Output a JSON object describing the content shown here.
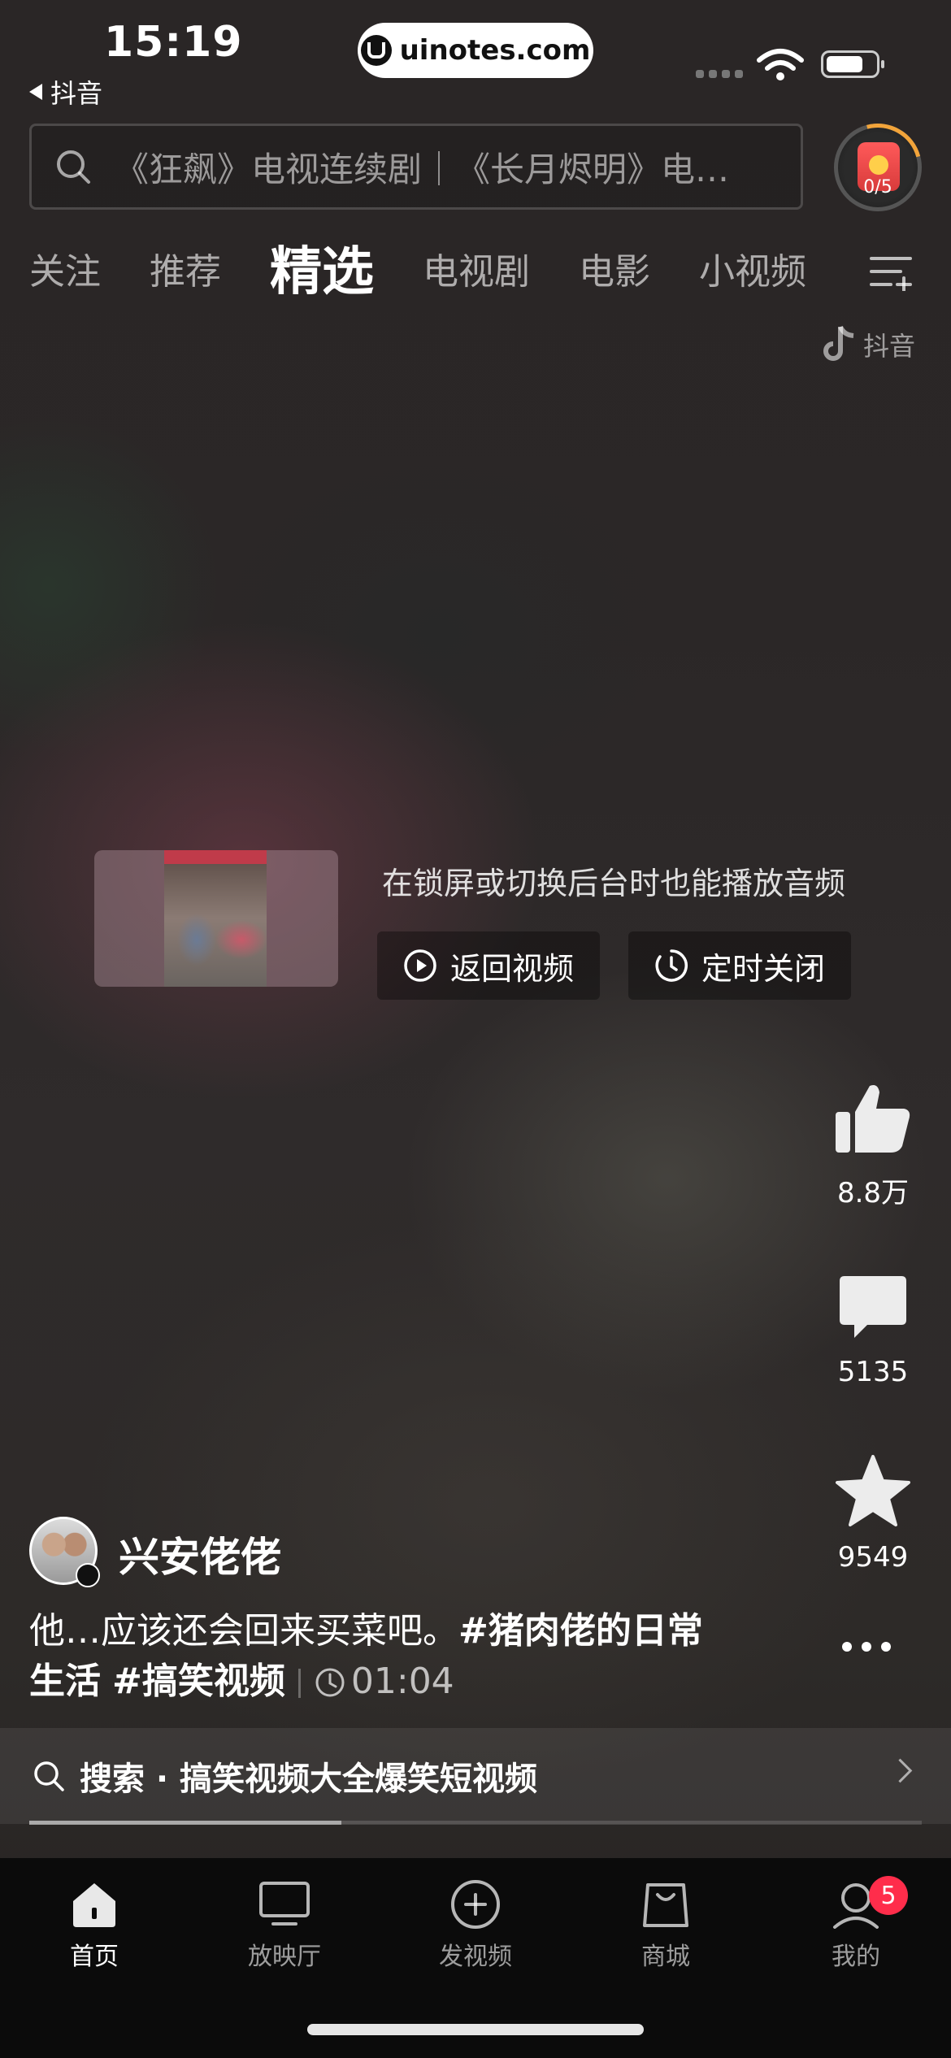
{
  "status_bar": {
    "time": "15:19",
    "back_app": "抖音",
    "url": "uinotes.com"
  },
  "search": {
    "placeholder_text": "《狂飙》电视连续剧｜《长月烬明》电…"
  },
  "reward": {
    "progress": "0/5"
  },
  "tabs": [
    {
      "label": "关注",
      "active": false
    },
    {
      "label": "推荐",
      "active": false
    },
    {
      "label": "精选",
      "active": true
    },
    {
      "label": "电视剧",
      "active": false
    },
    {
      "label": "电影",
      "active": false
    },
    {
      "label": "小视频",
      "active": false
    }
  ],
  "watermark": "抖音",
  "background_play": {
    "message": "在锁屏或切换后台时也能播放音频",
    "return_label": "返回视频",
    "timer_label": "定时关闭"
  },
  "actions": {
    "likes": "8.8万",
    "comments": "5135",
    "favorites": "9549"
  },
  "author": {
    "name": "兴安佬佬"
  },
  "caption": {
    "text": "他…应该还会回来买菜吧。",
    "tag1": "#猪肉佬的日常生活",
    "tag2": "#搞笑视频",
    "duration": "01:04"
  },
  "related_search": {
    "label": "搜索 · 搞笑视频大全爆笑短视频"
  },
  "playback": {
    "progress": 0.35
  },
  "bottom_nav": [
    {
      "label": "首页",
      "active": true
    },
    {
      "label": "放映厅",
      "active": false
    },
    {
      "label": "发视频",
      "active": false
    },
    {
      "label": "商城",
      "active": false
    },
    {
      "label": "我的",
      "active": false,
      "badge": "5"
    }
  ],
  "colors": {
    "badge": "#ff2d4b",
    "reward_ring": "#f2a43a"
  }
}
